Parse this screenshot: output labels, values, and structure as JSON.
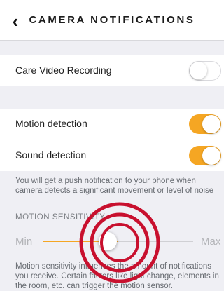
{
  "header": {
    "back_icon": "chevron-left-icon",
    "title": "CAMERA NOTIFICATIONS"
  },
  "care_video": {
    "label": "Care Video Recording",
    "enabled": false
  },
  "motion_detection": {
    "label": "Motion detection",
    "enabled": true
  },
  "sound_detection": {
    "label": "Sound detection",
    "enabled": true
  },
  "push_note": "You will get a push notification to your phone when camera detects a significant movement or level of noise",
  "sensitivity": {
    "section_label": "MOTION SENSITIVITY",
    "min_label": "Min",
    "max_label": "Max",
    "value": 0.5,
    "note": "Motion sensitivity influences the amount of notifications you receive. Certain factors like light change, elements in the room, etc. can trigger the motion sensor."
  },
  "colors": {
    "accent": "#f5a623",
    "highlight_ring": "#c8102e"
  }
}
